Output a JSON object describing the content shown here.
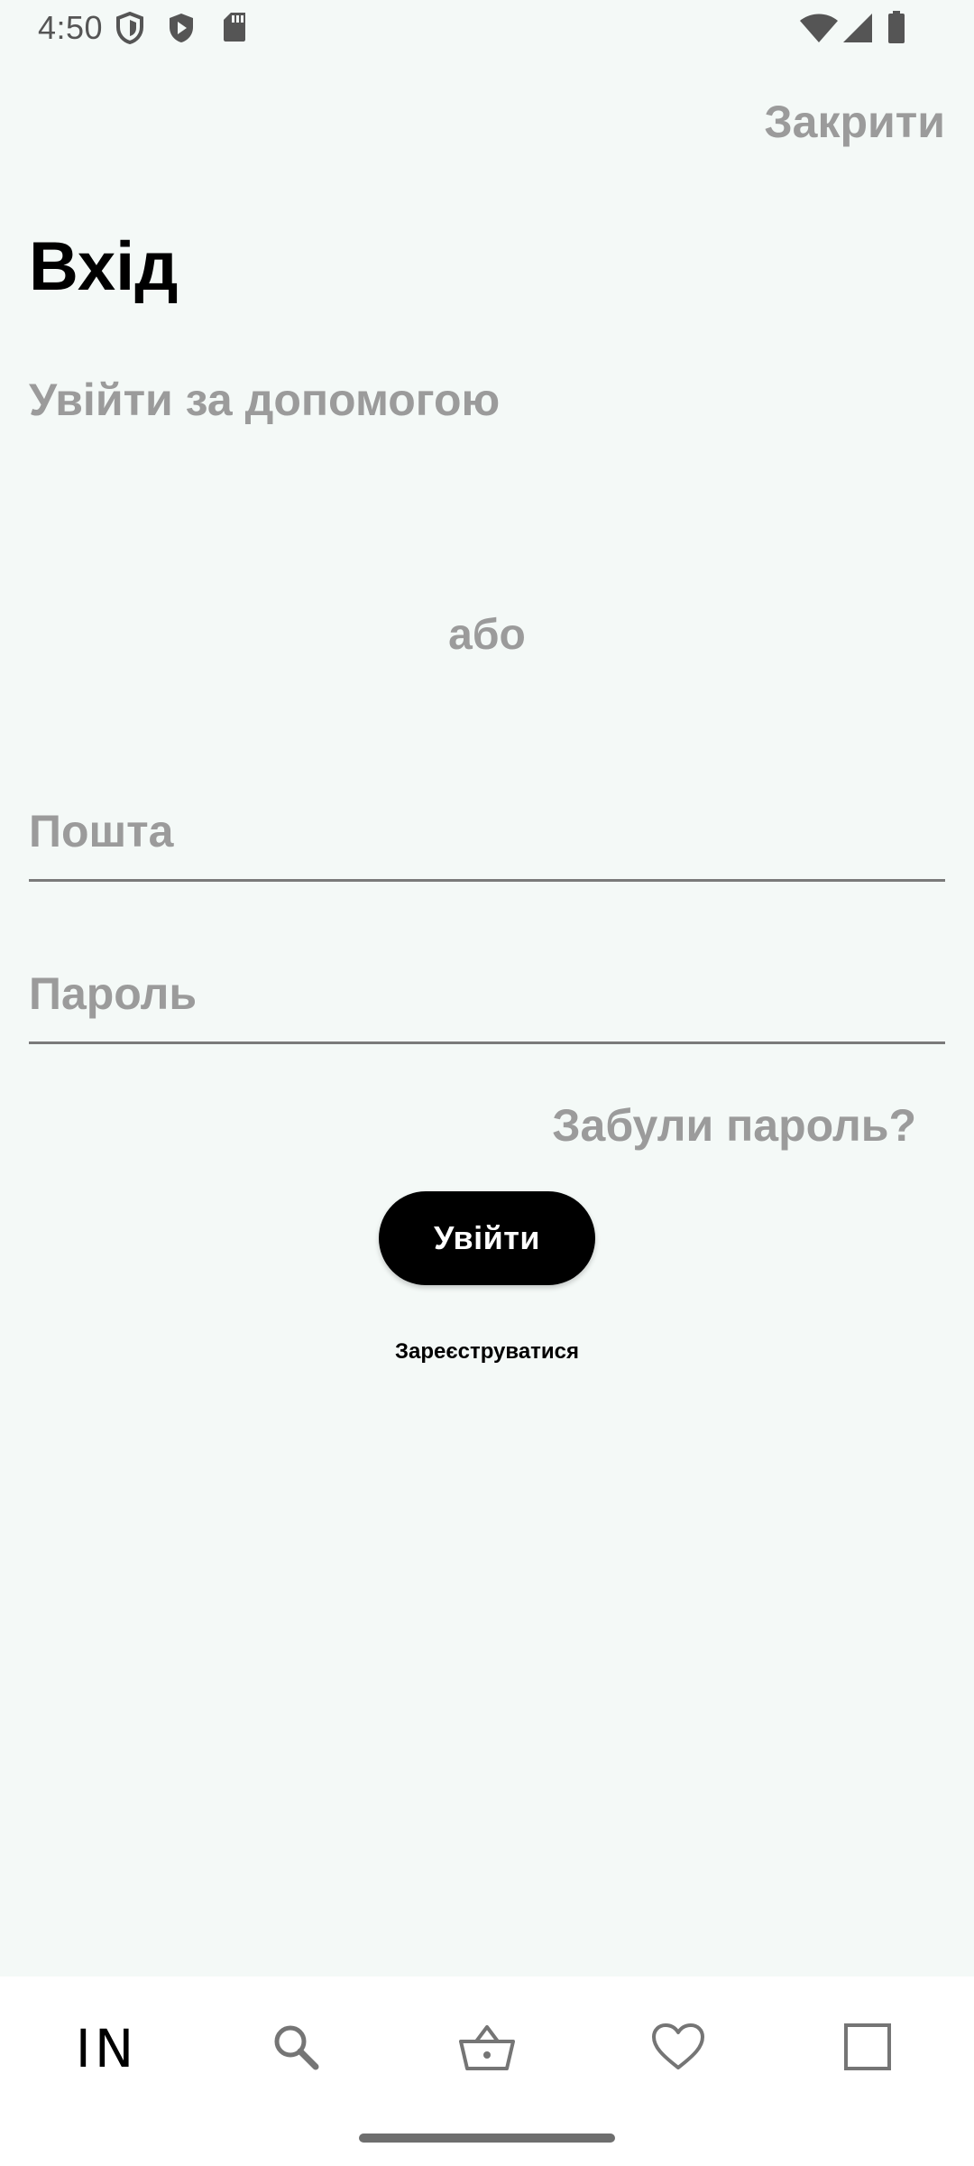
{
  "status_bar": {
    "time": "4:50",
    "left_icons": [
      "shield-icon",
      "play-protect-icon",
      "sd-card-icon"
    ],
    "right_icons": [
      "wifi-icon",
      "signal-icon",
      "battery-icon"
    ]
  },
  "header": {
    "close_label": "Закрити"
  },
  "login": {
    "title": "Вхід",
    "social_label": "Увійти за допомогою",
    "or_label": "або",
    "email_placeholder": "Пошта",
    "password_placeholder": "Пароль",
    "forgot_label": "Забули пароль?",
    "submit_label": "Увійти",
    "register_label": "Зареєструватися"
  },
  "bottom_nav": {
    "logo_text": "IN",
    "items": [
      {
        "name": "home",
        "icon": "logo-icon"
      },
      {
        "name": "search",
        "icon": "search-icon"
      },
      {
        "name": "basket",
        "icon": "basket-icon"
      },
      {
        "name": "favorites",
        "icon": "heart-icon"
      },
      {
        "name": "profile",
        "icon": "square-icon"
      }
    ]
  },
  "colors": {
    "background": "#f4f9f7",
    "muted_text": "#9b9b9b",
    "primary": "#000000",
    "nav_background": "#ffffff"
  }
}
